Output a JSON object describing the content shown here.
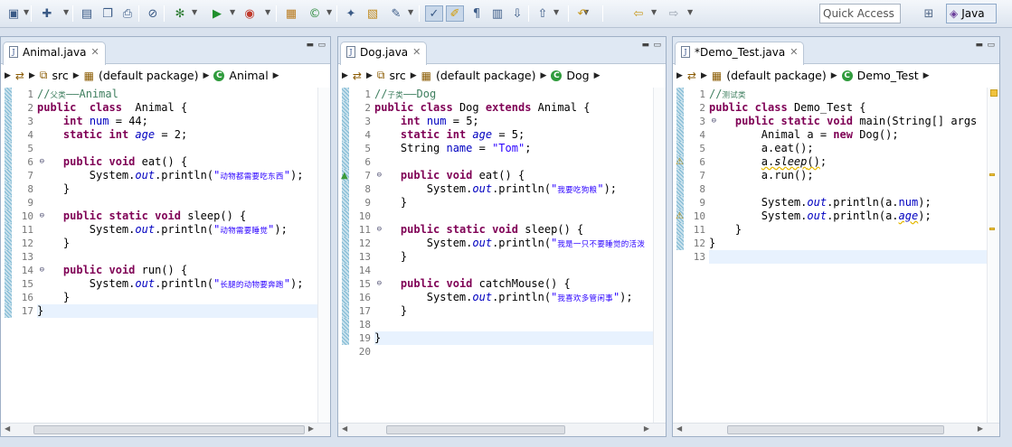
{
  "toolbar": {
    "icons": [
      "new-icon",
      "new-java-icon",
      "save-icon",
      "save-all-icon",
      "print-icon",
      "skip-breakpoints-icon",
      "debug-icon",
      "run-icon",
      "run-external-icon",
      "new-java-project-icon",
      "new-class-icon",
      "open-type-icon",
      "open-resource-icon",
      "search-icon",
      "toggle-mark-occurrences-icon",
      "toggle-highlight-icon",
      "show-whitespace-icon",
      "block-selection-icon",
      "next-annotation-icon",
      "previous-annotation-icon",
      "last-edit-location-icon",
      "back-icon",
      "forward-icon"
    ],
    "quick_access_placeholder": "Quick Access",
    "perspective_label": "Java"
  },
  "editors": [
    {
      "tab_label": "Animal.java",
      "breadcrumb": {
        "src": "src",
        "package": "(default package)",
        "class": "Animal"
      },
      "lines": [
        [
          [
            "cm",
            "//"
          ],
          [
            "cm cjk",
            "父类"
          ],
          [
            "cm",
            "——Animal"
          ]
        ],
        [
          [
            "kw",
            "public"
          ],
          [
            "",
            "  "
          ],
          [
            "kw",
            "class"
          ],
          [
            "",
            "  Animal "
          ],
          [
            "",
            "{"
          ]
        ],
        [
          [
            "",
            "    "
          ],
          [
            "kw",
            "int"
          ],
          [
            "",
            " "
          ],
          [
            "fld",
            "num"
          ],
          [
            "",
            " = 44;"
          ]
        ],
        [
          [
            "",
            "    "
          ],
          [
            "kw",
            "static"
          ],
          [
            "",
            " "
          ],
          [
            "kw",
            "int"
          ],
          [
            "",
            " "
          ],
          [
            "ov",
            "age"
          ],
          [
            "",
            " = 2;"
          ]
        ],
        [],
        [
          [
            "",
            "    "
          ],
          [
            "kw",
            "public"
          ],
          [
            "",
            " "
          ],
          [
            "kw",
            "void"
          ],
          [
            "",
            " eat() {"
          ]
        ],
        [
          [
            "",
            "        System."
          ],
          [
            "ov",
            "out"
          ],
          [
            "",
            ".println("
          ],
          [
            "str",
            "\""
          ],
          [
            "str cjk",
            "动物都需要吃东西"
          ],
          [
            "str",
            "\""
          ],
          [
            "",
            ");"
          ]
        ],
        [
          [
            "",
            "    }"
          ]
        ],
        [],
        [
          [
            "",
            "    "
          ],
          [
            "kw",
            "public"
          ],
          [
            "",
            " "
          ],
          [
            "kw",
            "static"
          ],
          [
            "",
            " "
          ],
          [
            "kw",
            "void"
          ],
          [
            "",
            " sleep() {"
          ]
        ],
        [
          [
            "",
            "        System."
          ],
          [
            "ov",
            "out"
          ],
          [
            "",
            ".println("
          ],
          [
            "str",
            "\""
          ],
          [
            "str cjk",
            "动物需要睡觉"
          ],
          [
            "str",
            "\""
          ],
          [
            "",
            ");"
          ]
        ],
        [
          [
            "",
            "    }"
          ]
        ],
        [],
        [
          [
            "",
            "    "
          ],
          [
            "kw",
            "public"
          ],
          [
            "",
            " "
          ],
          [
            "kw",
            "void"
          ],
          [
            "",
            " run() {"
          ]
        ],
        [
          [
            "",
            "        System."
          ],
          [
            "ov",
            "out"
          ],
          [
            "",
            ".println("
          ],
          [
            "str",
            "\""
          ],
          [
            "str cjk",
            "长腿的动物要奔跑"
          ],
          [
            "str",
            "\""
          ],
          [
            "",
            ");"
          ]
        ],
        [
          [
            "",
            "    }"
          ]
        ],
        [
          [
            "",
            "}"
          ]
        ]
      ]
    },
    {
      "tab_label": "Dog.java",
      "breadcrumb": {
        "src": "src",
        "package": "(default package)",
        "class": "Dog"
      },
      "lines": [
        [
          [
            "cm",
            "//"
          ],
          [
            "cm cjk",
            "子类"
          ],
          [
            "cm",
            "——Dog"
          ]
        ],
        [
          [
            "kw",
            "public"
          ],
          [
            "",
            " "
          ],
          [
            "kw",
            "class"
          ],
          [
            "",
            " Dog "
          ],
          [
            "kw",
            "extends"
          ],
          [
            "",
            " Animal {"
          ]
        ],
        [
          [
            "",
            "    "
          ],
          [
            "kw",
            "int"
          ],
          [
            "",
            " "
          ],
          [
            "fld",
            "num"
          ],
          [
            "",
            " = 5;"
          ]
        ],
        [
          [
            "",
            "    "
          ],
          [
            "kw",
            "static"
          ],
          [
            "",
            " "
          ],
          [
            "kw",
            "int"
          ],
          [
            "",
            " "
          ],
          [
            "ov",
            "age"
          ],
          [
            "",
            " = 5;"
          ]
        ],
        [
          [
            "",
            "    String "
          ],
          [
            "fld",
            "name"
          ],
          [
            "",
            " = "
          ],
          [
            "str",
            "\"Tom\""
          ],
          [
            "",
            ";"
          ]
        ],
        [],
        [
          [
            "",
            "    "
          ],
          [
            "kw",
            "public"
          ],
          [
            "",
            " "
          ],
          [
            "kw",
            "void"
          ],
          [
            "",
            " eat() {"
          ]
        ],
        [
          [
            "",
            "        System."
          ],
          [
            "ov",
            "out"
          ],
          [
            "",
            ".println("
          ],
          [
            "str",
            "\""
          ],
          [
            "str cjk",
            "我要吃狗粮"
          ],
          [
            "str",
            "\""
          ],
          [
            "",
            ");"
          ]
        ],
        [
          [
            "",
            "    }"
          ]
        ],
        [],
        [
          [
            "",
            "    "
          ],
          [
            "kw",
            "public"
          ],
          [
            "",
            " "
          ],
          [
            "kw",
            "static"
          ],
          [
            "",
            " "
          ],
          [
            "kw",
            "void"
          ],
          [
            "",
            " sleep() {"
          ]
        ],
        [
          [
            "",
            "        System."
          ],
          [
            "ov",
            "out"
          ],
          [
            "",
            ".println("
          ],
          [
            "str",
            "\""
          ],
          [
            "str cjk",
            "我是一只不要睡觉的活泼"
          ]
        ],
        [
          [
            "",
            "    }"
          ]
        ],
        [],
        [
          [
            "",
            "    "
          ],
          [
            "kw",
            "public"
          ],
          [
            "",
            " "
          ],
          [
            "kw",
            "void"
          ],
          [
            "",
            " catchMouse() {"
          ]
        ],
        [
          [
            "",
            "        System."
          ],
          [
            "ov",
            "out"
          ],
          [
            "",
            ".println("
          ],
          [
            "str",
            "\""
          ],
          [
            "str cjk",
            "我喜欢多管闲事"
          ],
          [
            "str",
            "\""
          ],
          [
            "",
            ");"
          ]
        ],
        [
          [
            "",
            "    }"
          ]
        ],
        [],
        [
          [
            "",
            "}"
          ]
        ],
        []
      ]
    },
    {
      "tab_label": "*Demo_Test.java",
      "breadcrumb": {
        "src": "",
        "package": "(default package)",
        "class": "Demo_Test"
      },
      "lines": [
        [
          [
            "cm",
            "//"
          ],
          [
            "cm cjk",
            "测试类"
          ]
        ],
        [
          [
            "kw",
            "public"
          ],
          [
            "",
            " "
          ],
          [
            "kw",
            "class"
          ],
          [
            "",
            " Demo_Test {"
          ]
        ],
        [
          [
            "",
            "    "
          ],
          [
            "kw",
            "public"
          ],
          [
            "",
            " "
          ],
          [
            "kw",
            "static"
          ],
          [
            "",
            " "
          ],
          [
            "kw",
            "void"
          ],
          [
            "",
            " main(String[] args"
          ]
        ],
        [
          [
            "",
            "        Animal a = "
          ],
          [
            "kw",
            "new"
          ],
          [
            "",
            " Dog();"
          ]
        ],
        [
          [
            "",
            "        a.eat();"
          ]
        ],
        [
          [
            "",
            "        "
          ],
          [
            "sqg",
            "a."
          ],
          [
            "sqg it",
            "sleep"
          ],
          [
            "sqg",
            "()"
          ],
          [
            "",
            ";"
          ]
        ],
        [
          [
            "",
            "        a.run();"
          ]
        ],
        [],
        [
          [
            "",
            "        System."
          ],
          [
            "ov",
            "out"
          ],
          [
            "",
            ".println(a."
          ],
          [
            "fld",
            "num"
          ],
          [
            "",
            ");"
          ]
        ],
        [
          [
            "",
            "        System."
          ],
          [
            "ov",
            "out"
          ],
          [
            "",
            ".println(a."
          ],
          [
            "sqg ov",
            "age"
          ],
          [
            "",
            ");"
          ]
        ],
        [
          [
            "",
            "    }"
          ]
        ],
        [
          [
            "",
            "}"
          ]
        ],
        []
      ]
    }
  ]
}
